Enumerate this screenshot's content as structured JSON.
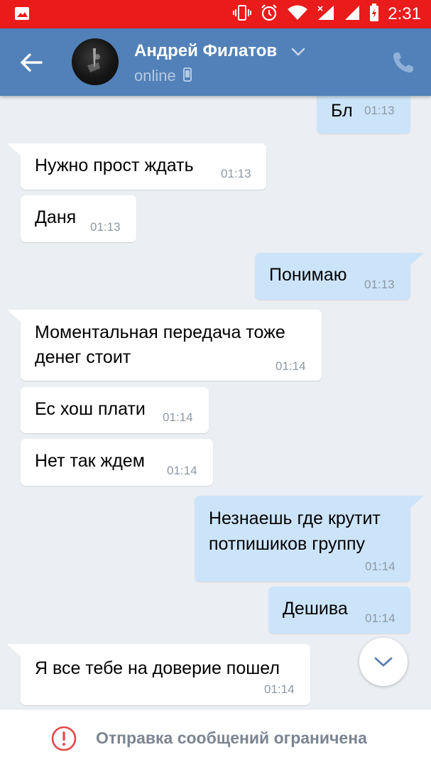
{
  "status_bar": {
    "time": "2:31"
  },
  "header": {
    "contact_name": "Андрей Филатов",
    "status": "online"
  },
  "messages": [
    {
      "direction": "out",
      "text": "Бл",
      "time": "01:13"
    },
    {
      "direction": "in",
      "text": "Нужно прост ждать",
      "time": "01:13"
    },
    {
      "direction": "in",
      "text": "Даня",
      "time": "01:13"
    },
    {
      "direction": "out",
      "text": "Понимаю",
      "time": "01:13"
    },
    {
      "direction": "in",
      "line1": "Моментальная передача тоже",
      "line2": "денег стоит",
      "time": "01:14"
    },
    {
      "direction": "in",
      "text": "Ес хош плати",
      "time": "01:14"
    },
    {
      "direction": "in",
      "text": "Нет так ждем",
      "time": "01:14"
    },
    {
      "direction": "out",
      "line1": "Незнаешь где крутит",
      "line2": "потпишиков группу",
      "time": "01:14"
    },
    {
      "direction": "out",
      "text": "Дешива",
      "time": "01:14"
    },
    {
      "direction": "in",
      "text": "Я все тебе на доверие пошел",
      "time": "01:14"
    }
  ],
  "bottom_bar": {
    "notice": "Отправка сообщений ограничена"
  },
  "colors": {
    "status_bar": "#ea1b1b",
    "header": "#5181b8",
    "incoming_bubble": "#ffffff",
    "outgoing_bubble": "#cce4fa",
    "chat_background": "#ebeef2",
    "warning": "#e64646"
  }
}
